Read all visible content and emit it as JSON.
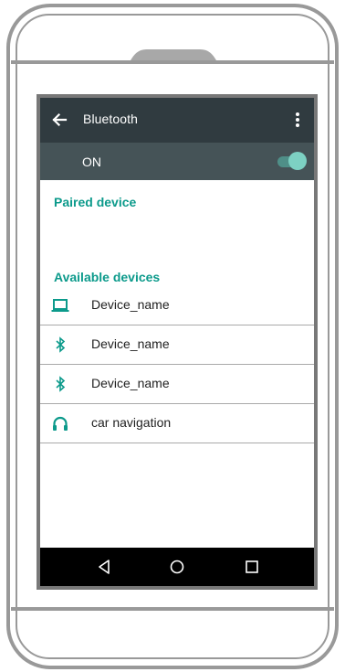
{
  "toolbar": {
    "title": "Bluetooth",
    "back_icon": "arrow-back-icon",
    "more_icon": "more-vert-icon"
  },
  "bluetooth_switch": {
    "label": "ON",
    "enabled": true
  },
  "sections": {
    "paired_header": "Paired device",
    "available_header": "Available devices"
  },
  "devices": [
    {
      "name": "Device_name",
      "icon": "laptop-icon"
    },
    {
      "name": "Device_name",
      "icon": "bluetooth-icon"
    },
    {
      "name": "Device_name",
      "icon": "bluetooth-icon"
    },
    {
      "name": "car navigation",
      "icon": "headset-icon"
    }
  ],
  "colors": {
    "accent": "#0c9a8b",
    "toolbar": "#303b40",
    "switchbar": "#455357",
    "toggle_thumb": "#7dd1c3",
    "navbar": "#000000"
  }
}
